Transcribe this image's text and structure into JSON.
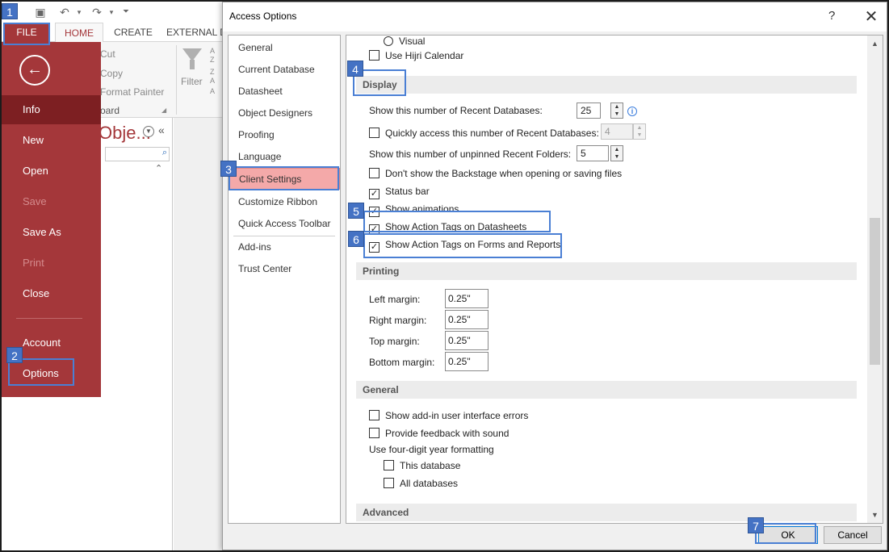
{
  "access": {
    "tabs": [
      "FILE",
      "HOME",
      "CREATE",
      "EXTERNAL D"
    ],
    "clipboard": [
      "Cut",
      "Copy",
      "Format Painter"
    ],
    "clipboard_group": "oard",
    "filter": "Filter",
    "nav_title": "Obje..."
  },
  "backstage": {
    "items": [
      {
        "label": "Info",
        "state": "active"
      },
      {
        "label": "New",
        "state": "normal"
      },
      {
        "label": "Open",
        "state": "normal"
      },
      {
        "label": "Save",
        "state": "disabled"
      },
      {
        "label": "Save As",
        "state": "normal"
      },
      {
        "label": "Print",
        "state": "disabled"
      },
      {
        "label": "Close",
        "state": "normal"
      },
      {
        "label": "Account",
        "state": "normal"
      },
      {
        "label": "Options",
        "state": "normal"
      }
    ]
  },
  "dialog": {
    "title": "Access Options",
    "help": "?",
    "close": "✕",
    "categories": [
      "General",
      "Current Database",
      "Datasheet",
      "Object Designers",
      "Proofing",
      "Language",
      "Client Settings",
      "Customize Ribbon",
      "Quick Access Toolbar",
      "Add-ins",
      "Trust Center"
    ],
    "selected_category": "Client Settings",
    "top": {
      "visual_label": "Visual",
      "hijri_label": "Use Hijri Calendar"
    },
    "display": {
      "heading": "Display",
      "recent_db_label": "Show this number of Recent Databases:",
      "recent_db_value": "25",
      "quick_access_label": "Quickly access this number of Recent Databases:",
      "quick_access_value": "4",
      "unpinned_folders_label": "Show this number of unpinned Recent Folders:",
      "unpinned_folders_value": "5",
      "backstage_label": "Don't show the Backstage when opening or saving files",
      "status_bar_label": "Status bar",
      "animations_label": "Show animations",
      "action_tags_ds_label": "Show Action Tags on Datasheets",
      "action_tags_fr_label": "Show Action Tags on Forms and Reports"
    },
    "printing": {
      "heading": "Printing",
      "margins": [
        {
          "label": "Left margin:",
          "value": "0.25\""
        },
        {
          "label": "Right margin:",
          "value": "0.25\""
        },
        {
          "label": "Top margin:",
          "value": "0.25\""
        },
        {
          "label": "Bottom margin:",
          "value": "0.25\""
        }
      ]
    },
    "general": {
      "heading": "General",
      "addin_errors_label": "Show add-in user interface errors",
      "feedback_label": "Provide feedback with sound",
      "four_digit_label": "Use four-digit year formatting",
      "this_db_label": "This database",
      "all_db_label": "All databases"
    },
    "advanced": {
      "heading": "Advanced"
    },
    "ok_label": "OK",
    "cancel_label": "Cancel"
  },
  "steps": [
    "1",
    "2",
    "3",
    "4",
    "5",
    "6",
    "7"
  ],
  "colors": {
    "access_red": "#a4373a",
    "highlight": "#4472c4",
    "selected_category": "#f4a9a9"
  }
}
